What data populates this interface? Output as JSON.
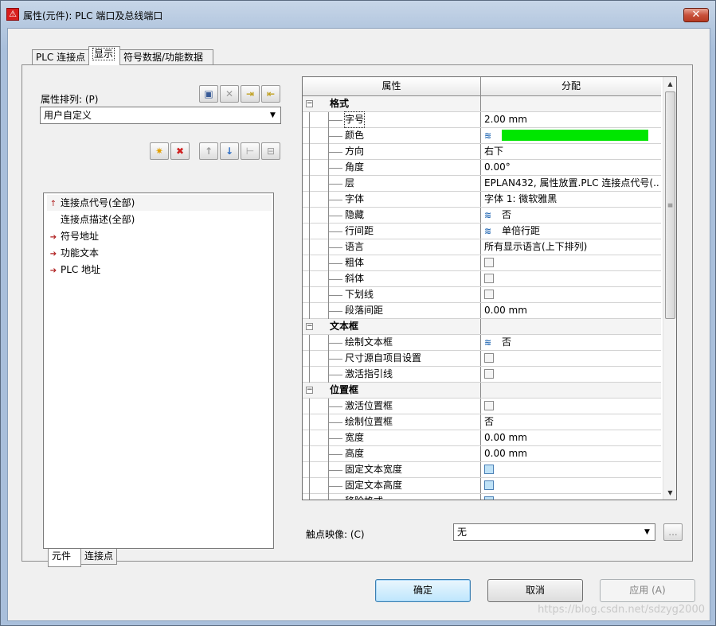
{
  "window": {
    "title": "属性(元件): PLC 端口及总线端口",
    "close_label": "✕"
  },
  "tabs": [
    {
      "label": "PLC 连接点"
    },
    {
      "label": "显示"
    },
    {
      "label": "符号数据/功能数据"
    }
  ],
  "left": {
    "sort_label": "属性排列: (P)",
    "sort_value": "用户自定义",
    "tree_items": [
      {
        "label": "连接点代号(全部)"
      },
      {
        "label": "连接点描述(全部)"
      },
      {
        "label": "符号地址"
      },
      {
        "label": "功能文本"
      },
      {
        "label": "PLC 地址"
      }
    ],
    "bottom_tabs": [
      {
        "label": "元件"
      },
      {
        "label": "连接点"
      }
    ]
  },
  "grid": {
    "col_property": "属性",
    "col_value": "分配",
    "rows": [
      {
        "name": "格式",
        "value": "",
        "category": true
      },
      {
        "name": "字号",
        "value": "2.00 mm"
      },
      {
        "name": "颜色",
        "value": "",
        "color": "#00e600"
      },
      {
        "name": "方向",
        "value": "右下"
      },
      {
        "name": "角度",
        "value": "0.00°"
      },
      {
        "name": "层",
        "value": "EPLAN432, 属性放置.PLC 连接点代号(..."
      },
      {
        "name": "字体",
        "value": "字体 1: 微软雅黑"
      },
      {
        "name": "隐藏",
        "value": "否"
      },
      {
        "name": "行间距",
        "value": "单倍行距"
      },
      {
        "name": "语言",
        "value": "所有显示语言(上下排列)"
      },
      {
        "name": "粗体",
        "value": ""
      },
      {
        "name": "斜体",
        "value": ""
      },
      {
        "name": "下划线",
        "value": ""
      },
      {
        "name": "段落间距",
        "value": "0.00 mm"
      },
      {
        "name": "文本框",
        "value": "",
        "category": true
      },
      {
        "name": "绘制文本框",
        "value": "否"
      },
      {
        "name": "尺寸源自项目设置",
        "value": ""
      },
      {
        "name": "激活指引线",
        "value": ""
      },
      {
        "name": "位置框",
        "value": "",
        "category": true
      },
      {
        "name": "激活位置框",
        "value": ""
      },
      {
        "name": "绘制位置框",
        "value": "否"
      },
      {
        "name": "宽度",
        "value": "0.00 mm"
      },
      {
        "name": "高度",
        "value": "0.00 mm"
      },
      {
        "name": "固定文本宽度",
        "value": ""
      },
      {
        "name": "固定文本高度",
        "value": ""
      },
      {
        "name": "移除格式",
        "value": ""
      }
    ]
  },
  "mapping": {
    "label": "触点映像: (C)",
    "value": "无",
    "browse_label": "..."
  },
  "buttons": {
    "ok": "确定",
    "cancel": "取消",
    "apply": "应用 (A)"
  },
  "watermark": "https://blog.csdn.net/sdzyg2000"
}
